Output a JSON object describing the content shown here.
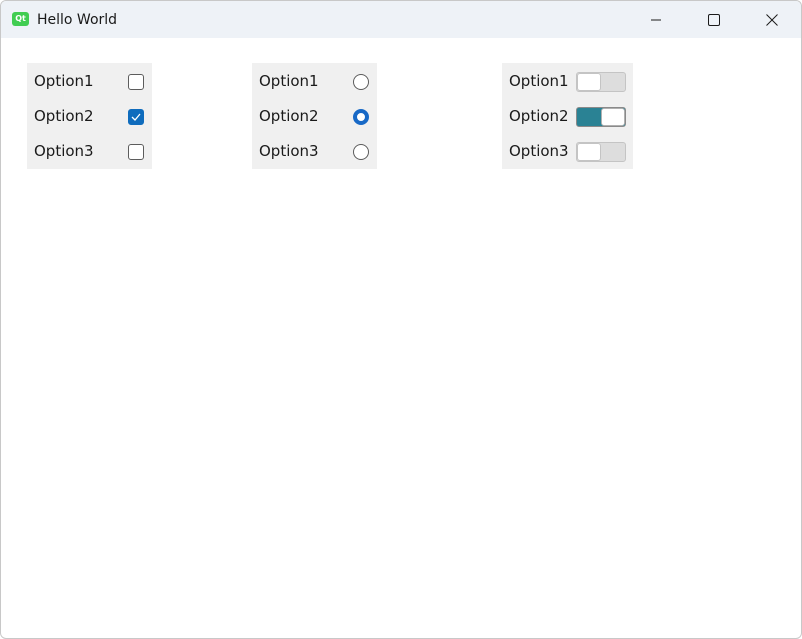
{
  "window": {
    "title": "Hello World",
    "app_icon_text": "Qt"
  },
  "controls": {
    "minimize": "minimize",
    "maximize": "maximize",
    "close": "close"
  },
  "checkbox_group": {
    "items": [
      {
        "label": "Option1",
        "checked": false
      },
      {
        "label": "Option2",
        "checked": true
      },
      {
        "label": "Option3",
        "checked": false
      }
    ]
  },
  "radio_group": {
    "items": [
      {
        "label": "Option1",
        "checked": false
      },
      {
        "label": "Option2",
        "checked": true
      },
      {
        "label": "Option3",
        "checked": false
      }
    ]
  },
  "switch_group": {
    "items": [
      {
        "label": "Option1",
        "on": false
      },
      {
        "label": "Option2",
        "on": true
      },
      {
        "label": "Option3",
        "on": false
      }
    ]
  },
  "colors": {
    "accent": "#0f6cbd",
    "switch_on": "#2a8294",
    "titlebar": "#eef2f7",
    "group_bg": "#f0f0f0"
  }
}
